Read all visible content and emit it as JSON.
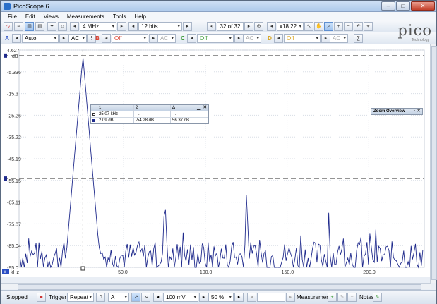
{
  "window": {
    "title": "PicoScope 6"
  },
  "menu": [
    "File",
    "Edit",
    "Views",
    "Measurements",
    "Tools",
    "Help"
  ],
  "toolbar1": {
    "sample_rate": "4 MHz",
    "resolution": "12 bits",
    "capture_index": "32 of 32",
    "zoom": "x18.22"
  },
  "toolbar2": {
    "channel_a": {
      "tag": "A",
      "range": "Auto",
      "coupling": "AC",
      "color": "#2b4fc4"
    },
    "channel_b": {
      "tag": "B",
      "range": "Off",
      "coupling": "AC",
      "color": "#d83b2b"
    },
    "channel_c": {
      "tag": "C",
      "range": "Off",
      "coupling": "AC",
      "color": "#3a9a35"
    },
    "channel_d": {
      "tag": "D",
      "range": "Off",
      "coupling": "AC",
      "color": "#d7a21b"
    }
  },
  "logo": {
    "text": "pico",
    "subtitle": "Technology"
  },
  "scope": {
    "y_ticks": [
      "4.627",
      "-5.336",
      "-15.3",
      "-25.26",
      "-35.22",
      "-45.19",
      "-55.15",
      "-65.11",
      "-75.07",
      "-85.04",
      "-95.0"
    ],
    "y_unit": "dB",
    "x_ticks": [
      "50.0",
      "100.0",
      "150.0",
      "200.0"
    ],
    "x_unit": "kHz",
    "x_label_box": "A"
  },
  "measurement_table": {
    "headers": [
      "1",
      "2",
      "Δ"
    ],
    "rows": [
      [
        "25.07 kHz",
        "--.--",
        "--.--"
      ],
      [
        "2.09 dB",
        "-54.28 dB",
        "56.37 dB"
      ]
    ]
  },
  "zoom_overview": {
    "title": "Zoom Overview"
  },
  "statusbar": {
    "run_state": "Stopped",
    "trigger_label": "Trigger",
    "trigger_mode": "Repeat",
    "trigger_channel": "A",
    "trigger_level": "100 mV",
    "pretrigger": "50 %",
    "measurements_label": "Measurements",
    "notes_label": "Notes"
  },
  "chart_data": {
    "type": "line",
    "title": "",
    "xlabel": "kHz",
    "ylabel": "dB",
    "xlim": [
      -14,
      234
    ],
    "ylim": [
      -95.0,
      4.627
    ],
    "series": [
      {
        "name": "",
        "color": "#1f2a8c",
        "peaks": [
          {
            "x": 25.07,
            "y": 2.09
          },
          {
            "x": 75.2,
            "y": -57.5
          },
          {
            "x": 125.3,
            "y": -56.2
          },
          {
            "x": 175.5,
            "y": -70.0
          },
          {
            "x": 200.5,
            "y": -74.0
          },
          {
            "x": 150.4,
            "y": -86.0
          },
          {
            "x": 225.6,
            "y": -86.0
          }
        ],
        "noise_floor": -90.0
      }
    ],
    "rulers": [
      {
        "axis": "y",
        "value": 2.09
      },
      {
        "axis": "y",
        "value": -54.28
      },
      {
        "axis": "x",
        "value": 25.07
      }
    ]
  }
}
